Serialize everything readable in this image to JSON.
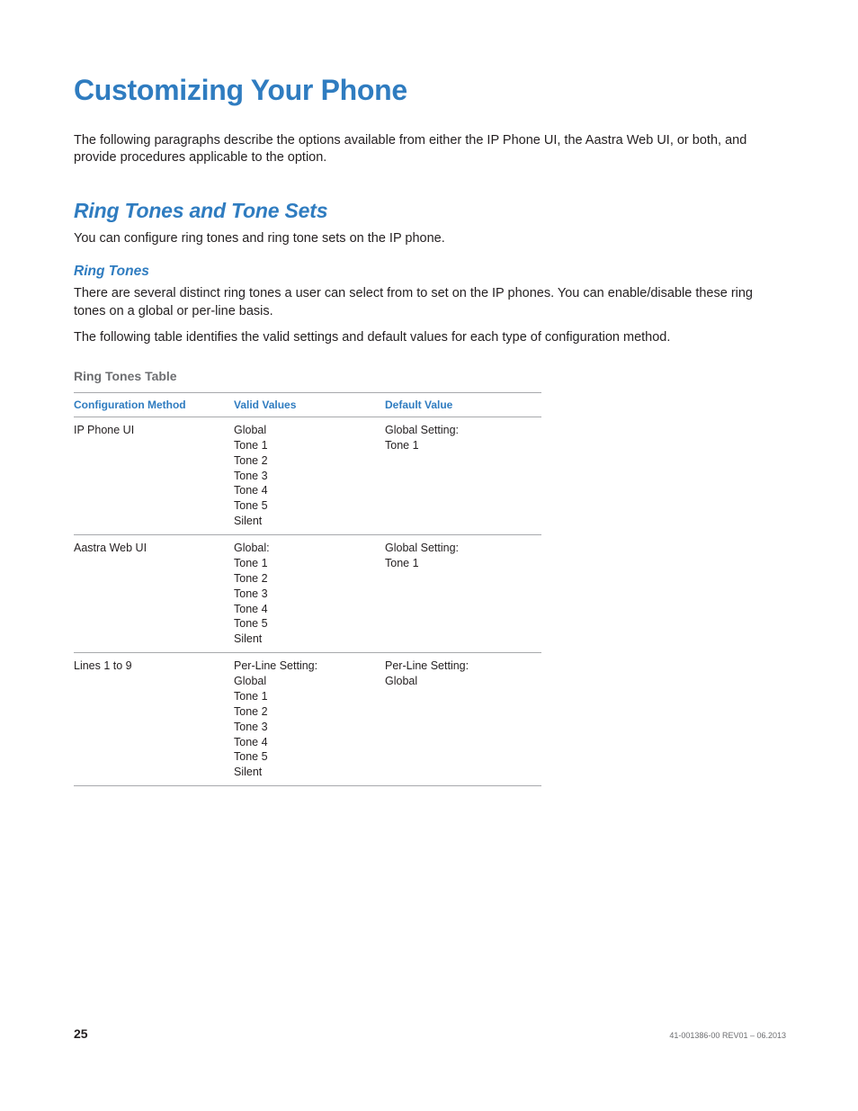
{
  "title": "Customizing Your Phone",
  "intro": "The following paragraphs describe the options available from either the IP Phone UI, the Aastra Web UI, or both, and provide procedures applicable to the option.",
  "section": {
    "heading": "Ring Tones and Tone Sets",
    "text": "You can configure ring tones and ring tone sets on the IP phone."
  },
  "subsection": {
    "heading": "Ring Tones",
    "para1": "There are several distinct ring tones a user can select from to set on the IP phones. You can enable/disable these ring tones on a global or per-line basis.",
    "para2": "The following table identifies the valid settings and default values for each type of configuration method."
  },
  "table": {
    "caption": "Ring Tones Table",
    "headers": [
      "Configuration Method",
      "Valid Values",
      "Default Value"
    ],
    "rows": [
      {
        "method": "IP Phone UI",
        "valid": "Global\nTone 1\nTone 2\nTone 3\nTone 4\nTone 5\nSilent",
        "default": "Global Setting:\nTone 1"
      },
      {
        "method": "Aastra Web UI",
        "valid": "Global:\nTone 1\nTone 2\nTone 3\nTone 4\nTone 5\nSilent",
        "default": "Global Setting:\nTone 1"
      },
      {
        "method": "Lines 1 to 9",
        "valid": "Per-Line Setting:\nGlobal\nTone 1\nTone 2\nTone 3\nTone 4\nTone 5\nSilent",
        "default": "Per-Line Setting:\nGlobal"
      }
    ]
  },
  "footer": {
    "page": "25",
    "docid": "41-001386-00 REV01 – 06.2013"
  }
}
